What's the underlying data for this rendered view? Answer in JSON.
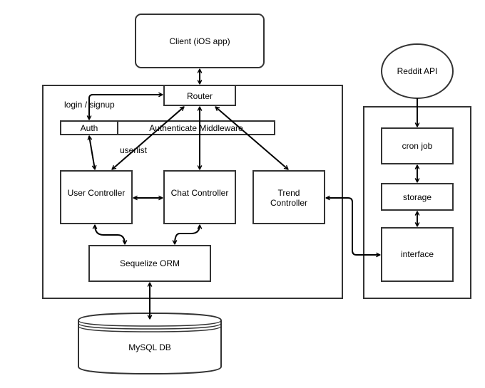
{
  "diagram": {
    "type": "architecture",
    "colors": {
      "stroke": "#333333",
      "background": "#ffffff",
      "text": "#000000"
    },
    "nodes": {
      "client": {
        "label": "Client (iOS app)",
        "shape": "rounded-rectangle"
      },
      "server_group": {
        "label": "",
        "shape": "container"
      },
      "router": {
        "label": "Router",
        "shape": "rectangle"
      },
      "auth": {
        "label": "Auth",
        "shape": "rectangle"
      },
      "auth_middleware": {
        "label": "Authenticate Middleware",
        "shape": "rectangle"
      },
      "user_controller": {
        "label": "User Controller",
        "shape": "rectangle"
      },
      "chat_controller": {
        "label": "Chat Controller",
        "shape": "rectangle"
      },
      "trend_controller": {
        "label_lines": [
          "Trend",
          "Controller"
        ],
        "shape": "rectangle"
      },
      "sequelize_orm": {
        "label": "Sequelize ORM",
        "shape": "rectangle"
      },
      "mysql_db": {
        "label": "MySQL DB",
        "shape": "cylinder"
      },
      "reddit_api": {
        "label": "Reddit API",
        "shape": "ellipse"
      },
      "trend_group": {
        "label": "",
        "shape": "container"
      },
      "cron_job": {
        "label": "cron job",
        "shape": "rectangle"
      },
      "storage": {
        "label": "storage",
        "shape": "rectangle"
      },
      "interface": {
        "label": "interface",
        "shape": "rectangle"
      }
    },
    "edge_labels": {
      "login_signup": "login / signup",
      "userlist": "userlist"
    },
    "edges": [
      {
        "from": "client",
        "to": "router",
        "direction": "both"
      },
      {
        "from": "auth",
        "to": "router",
        "direction": "both",
        "label": "login / signup"
      },
      {
        "from": "auth",
        "to": "user_controller",
        "direction": "both"
      },
      {
        "from": "router",
        "to": "user_controller",
        "direction": "both",
        "label": "userlist"
      },
      {
        "from": "router",
        "to": "chat_controller",
        "direction": "both"
      },
      {
        "from": "router",
        "to": "trend_controller",
        "direction": "both"
      },
      {
        "from": "user_controller",
        "to": "chat_controller",
        "direction": "both"
      },
      {
        "from": "user_controller",
        "to": "sequelize_orm",
        "direction": "both"
      },
      {
        "from": "chat_controller",
        "to": "sequelize_orm",
        "direction": "both"
      },
      {
        "from": "sequelize_orm",
        "to": "mysql_db",
        "direction": "both"
      },
      {
        "from": "reddit_api",
        "to": "cron_job",
        "direction": "forward"
      },
      {
        "from": "cron_job",
        "to": "storage",
        "direction": "both"
      },
      {
        "from": "storage",
        "to": "interface",
        "direction": "both"
      },
      {
        "from": "trend_controller",
        "to": "interface",
        "direction": "both"
      }
    ]
  }
}
